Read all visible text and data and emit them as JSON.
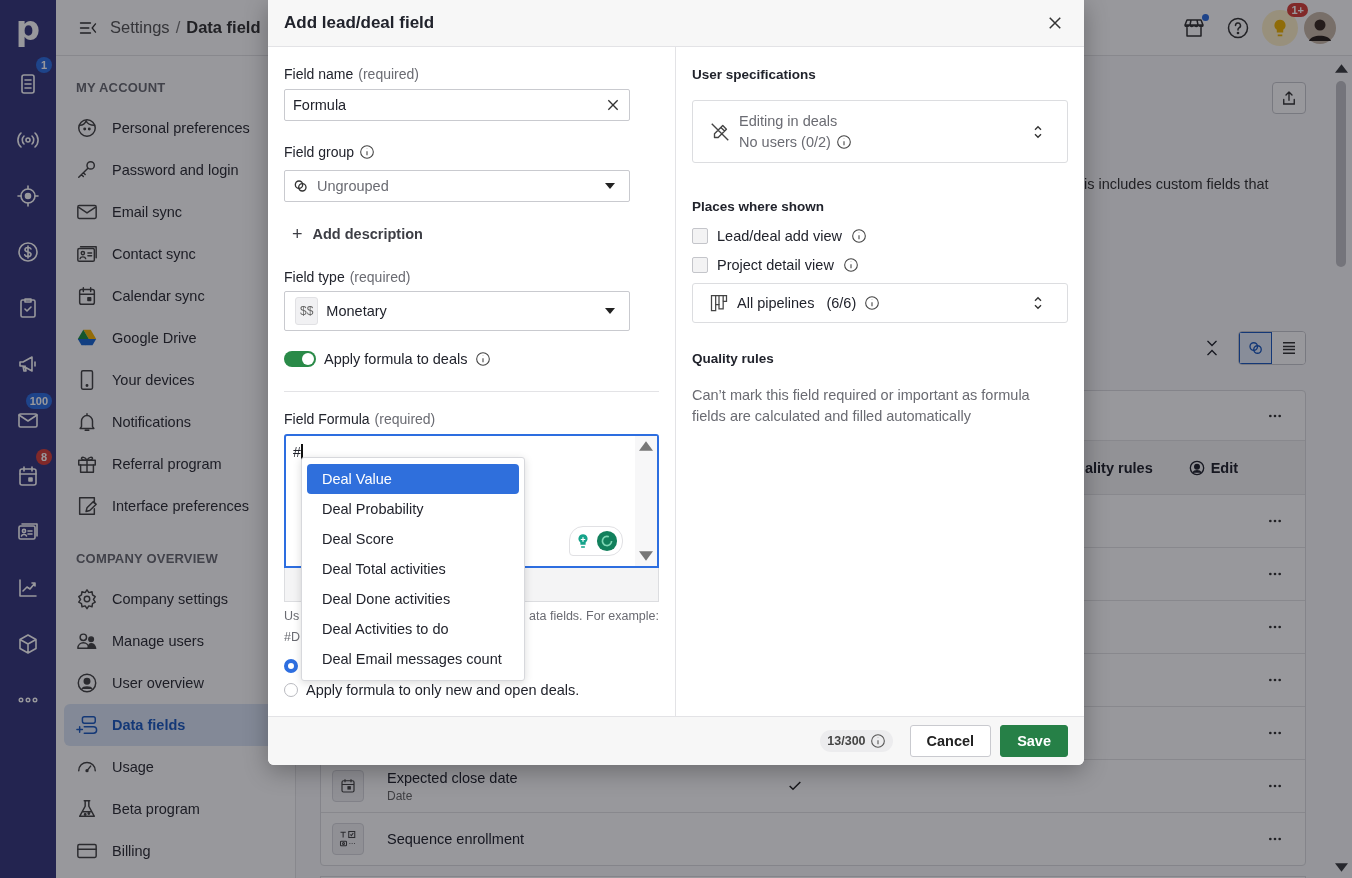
{
  "rail": {
    "logo": "p",
    "items": [
      {
        "kind": "list",
        "badge": "1",
        "alert": false
      },
      {
        "kind": "radio"
      },
      {
        "kind": "target"
      },
      {
        "kind": "dollar"
      },
      {
        "kind": "clipboard"
      },
      {
        "kind": "megaphone"
      },
      {
        "kind": "mail",
        "badge": "100",
        "alert": false
      },
      {
        "kind": "calendar",
        "badge": "8",
        "alert": true
      },
      {
        "kind": "card"
      },
      {
        "kind": "chart"
      },
      {
        "kind": "box"
      },
      {
        "kind": "more"
      }
    ]
  },
  "header": {
    "breadcrumb": [
      "Settings",
      "/",
      "Data field"
    ],
    "marketplace_dot": true,
    "notifications_badge": "1+"
  },
  "sidebar": {
    "sections": [
      {
        "title": "MY ACCOUNT",
        "items": [
          {
            "label": "Personal preferences",
            "kind": "face",
            "selected": false
          },
          {
            "label": "Password and login",
            "kind": "key",
            "selected": false
          },
          {
            "label": "Email sync",
            "kind": "envelope",
            "selected": false
          },
          {
            "label": "Contact sync",
            "kind": "contact",
            "selected": false
          },
          {
            "label": "Calendar sync",
            "kind": "calendar",
            "selected": false
          },
          {
            "label": "Google Drive",
            "kind": "drive",
            "selected": false
          },
          {
            "label": "Your devices",
            "kind": "phone",
            "selected": false
          },
          {
            "label": "Notifications",
            "kind": "bell",
            "selected": false
          },
          {
            "label": "Referral program",
            "kind": "gift",
            "selected": false
          },
          {
            "label": "Interface preferences",
            "kind": "edit",
            "selected": false
          }
        ]
      },
      {
        "title": "COMPANY OVERVIEW",
        "items": [
          {
            "label": "Company settings",
            "kind": "gear",
            "selected": false
          },
          {
            "label": "Manage users",
            "kind": "users",
            "selected": false
          },
          {
            "label": "User overview",
            "kind": "user",
            "selected": false
          },
          {
            "label": "Data fields",
            "kind": "fields",
            "selected": true
          },
          {
            "label": "Usage",
            "kind": "gauge",
            "selected": false
          },
          {
            "label": "Beta program",
            "kind": "flask",
            "selected": false
          },
          {
            "label": "Billing",
            "kind": "credit",
            "selected": false
          }
        ]
      }
    ]
  },
  "main": {
    "intro": "is includes custom fields that",
    "toolbar": {
      "views": [
        {
          "kind": "group",
          "selected": true
        },
        {
          "kind": "list",
          "selected": false
        }
      ]
    },
    "table": {
      "summary_rows": [
        {
          "kind": "covered"
        }
      ],
      "columns": [
        {
          "label": "ality rules",
          "kind": "text"
        },
        {
          "label": "Edit",
          "kind": "user"
        }
      ],
      "rows": [
        {
          "kind": "covered"
        },
        {
          "kind": "covered"
        },
        {
          "kind": "covered"
        },
        {
          "kind": "covered"
        },
        {
          "kind": "covered"
        },
        {
          "kind": "date",
          "name": "Expected close date",
          "type": "Date",
          "checked": true
        },
        {
          "kind": "sequence",
          "name": "Sequence enrollment",
          "checked": false
        }
      ]
    }
  },
  "modal": {
    "title": "Add lead/deal field",
    "field_name": {
      "label": "Field name",
      "hint": "(required)",
      "value": "Formula"
    },
    "field_group": {
      "label": "Field group",
      "value": "Ungrouped"
    },
    "add_description": {
      "icon": "+",
      "label": "Add description"
    },
    "field_type": {
      "label": "Field type",
      "hint": "(required)",
      "icon_text": "$$",
      "value": "Monetary"
    },
    "apply_toggle": {
      "label": "Apply formula to deals",
      "on": true
    },
    "formula": {
      "label": "Field Formula",
      "hint": "(required)",
      "value": "#"
    },
    "help": {
      "left": "Us",
      "right": "ata fields. For example:",
      "second_line": "#D"
    },
    "radios": [
      {
        "selected": true
      },
      {
        "label": "Apply formula to only new and open deals.",
        "selected": false
      }
    ],
    "suggestions": [
      {
        "label": "Deal Value",
        "selected": true
      },
      {
        "label": "Deal Probability",
        "selected": false
      },
      {
        "label": "Deal Score",
        "selected": false
      },
      {
        "label": "Deal Total activities",
        "selected": false
      },
      {
        "label": "Deal Done activities",
        "selected": false
      },
      {
        "label": "Deal Activities to do",
        "selected": false
      },
      {
        "label": "Deal Email messages count",
        "selected": false
      }
    ],
    "user_specifications": {
      "title": "User specifications",
      "primary": "Editing in deals",
      "secondary": "No users (0/2)"
    },
    "places": {
      "title": "Places where shown",
      "options": [
        {
          "label": "Lead/deal add view",
          "checked": false
        },
        {
          "label": "Project detail view",
          "checked": false
        }
      ],
      "pipelines": {
        "label": "All pipelines",
        "count": "(6/6)"
      }
    },
    "quality": {
      "title": "Quality rules",
      "text": "Can’t mark this field required or important as formula fields are calculated and filled automatically"
    },
    "footer": {
      "counter": "13/300",
      "buttons": [
        {
          "label": "Cancel",
          "kind": "secondary"
        },
        {
          "label": "Save",
          "kind": "primary"
        }
      ]
    }
  }
}
